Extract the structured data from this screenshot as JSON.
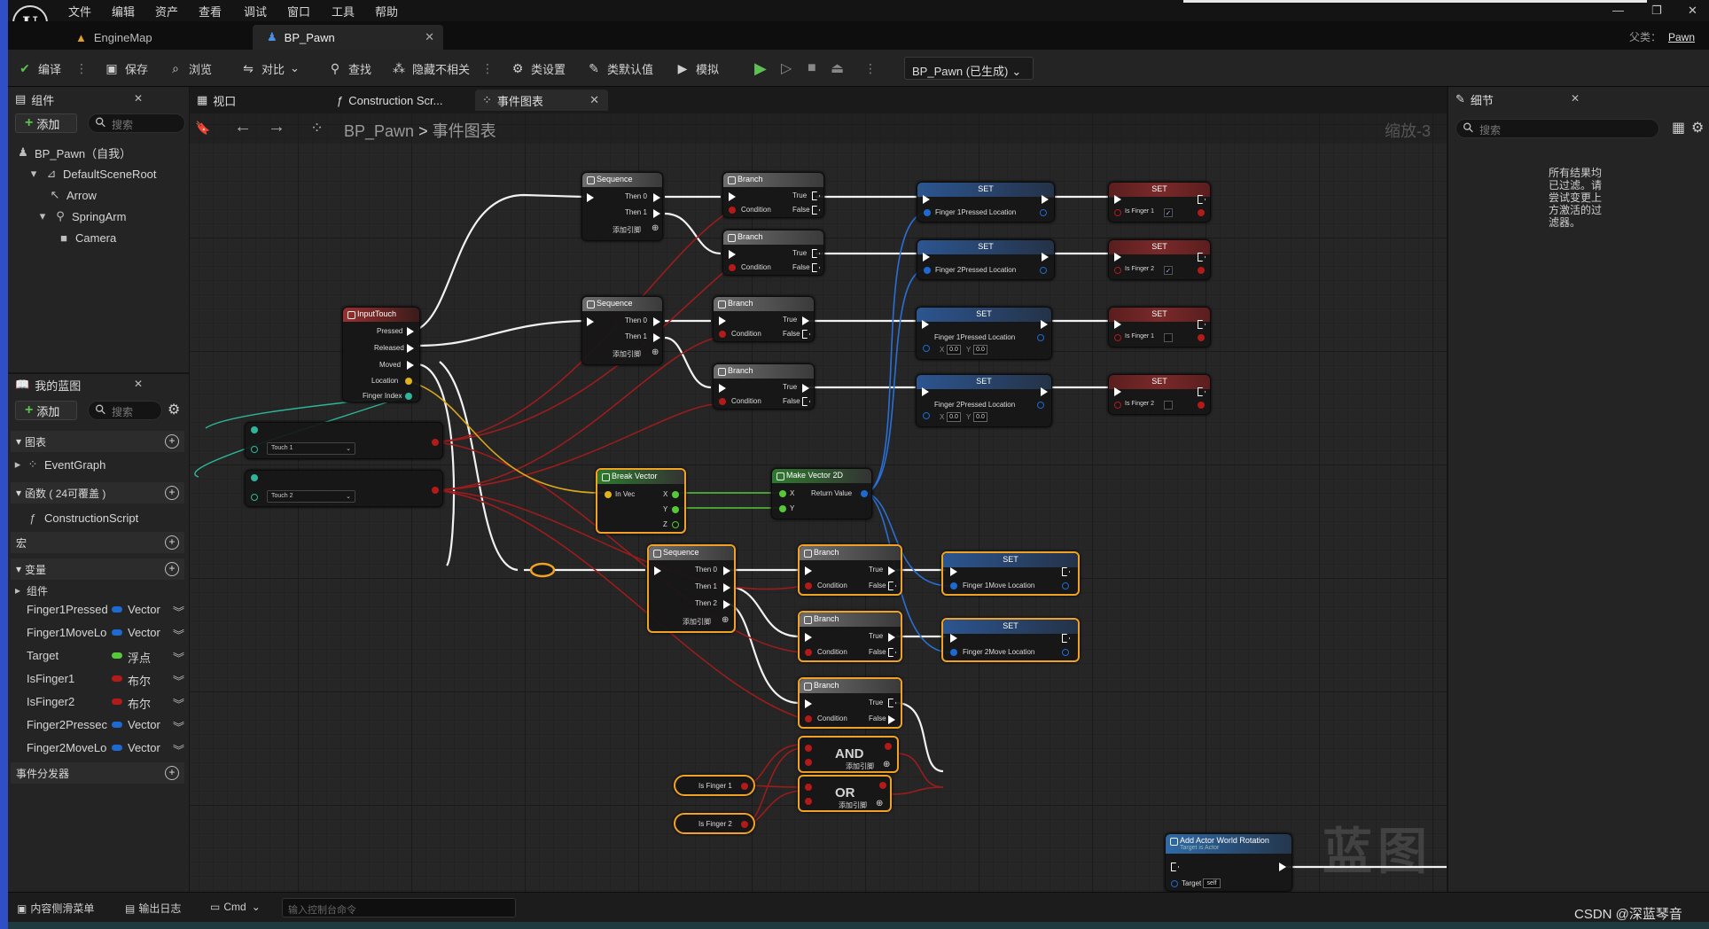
{
  "menu": [
    "文件",
    "编辑",
    "资产",
    "查看",
    "调试",
    "窗口",
    "工具",
    "帮助"
  ],
  "tabs": {
    "engine_map": "EngineMap",
    "bp_pawn": "BP_Pawn",
    "parent_label": "父类：",
    "parent_value": "Pawn"
  },
  "toolbar": {
    "compile": "编译",
    "save": "保存",
    "browse": "浏览",
    "diff": "对比",
    "find": "查找",
    "hide_unrelated": "隐藏不相关",
    "class_settings": "类设置",
    "class_defaults": "类默认值",
    "simulate": "模拟",
    "debug_object": "BP_Pawn (已生成)"
  },
  "components": {
    "tab": "组件",
    "add": "添加",
    "search_placeholder": "搜索",
    "tree": [
      "BP_Pawn（自我）",
      "DefaultSceneRoot",
      "Arrow",
      "SpringArm",
      "Camera"
    ]
  },
  "graph_tabs": {
    "viewport": "视口",
    "construction": "Construction Scr...",
    "event_graph": "事件图表"
  },
  "breadcrumb": {
    "root": "BP_Pawn",
    "sep": ">",
    "current": "事件图表"
  },
  "zoom": "缩放-3",
  "watermark": "蓝图",
  "myblueprint": {
    "tab": "我的蓝图",
    "add": "添加",
    "search_placeholder": "搜索",
    "graphs": "图表",
    "event_graph": "EventGraph",
    "functions": "函数 ( 24可覆盖 )",
    "construction_script": "ConstructionScript",
    "macros": "宏",
    "variables": "变量",
    "components_cat": "组件",
    "dispatchers": "事件分发器",
    "vars": [
      {
        "name": "Finger1Pressed",
        "type": "Vector",
        "color": "#1e6ad0"
      },
      {
        "name": "Finger1MoveLo",
        "type": "Vector",
        "color": "#1e6ad0"
      },
      {
        "name": "Target",
        "type": "浮点",
        "color": "#56c83a"
      },
      {
        "name": "IsFinger1",
        "type": "布尔",
        "color": "#b31a1a"
      },
      {
        "name": "IsFinger2",
        "type": "布尔",
        "color": "#b31a1a"
      },
      {
        "name": "Finger2Pressec",
        "type": "Vector",
        "color": "#1e6ad0"
      },
      {
        "name": "Finger2MoveLo",
        "type": "Vector",
        "color": "#1e6ad0"
      }
    ]
  },
  "details": {
    "tab": "细节",
    "search_placeholder": "搜索",
    "message": "所有结果均已过滤。请尝试变更上方激活的过滤器。"
  },
  "nodes": {
    "sequence": "Sequence",
    "branch": "Branch",
    "set": "SET",
    "input_touch": "InputTouch",
    "pressed": "Pressed",
    "released": "Released",
    "moved": "Moved",
    "location": "Location",
    "finger_index": "Finger Index",
    "then0": "Then 0",
    "then1": "Then 1",
    "then2": "Then 2",
    "add_pin": "添加引脚",
    "true": "True",
    "false": "False",
    "condition": "Condition",
    "f1_pressed": "Finger 1Pressed Location",
    "f2_pressed": "Finger 2Pressed Location",
    "is_finger1": "Is Finger 1",
    "is_finger2": "Is Finger 2",
    "touch1": "Touch 1",
    "touch2": "Touch 2",
    "break_vector": "Break Vector",
    "in_vec": "In Vec",
    "x": "X",
    "y": "Y",
    "z": "Z",
    "make_vector2d": "Make Vector 2D",
    "return_value": "Return Value",
    "f1_move": "Finger 1Move Location",
    "f2_move": "Finger 2Move Location",
    "and": "AND",
    "or": "OR",
    "add_rotation": "Add Actor World Rotation",
    "target_is_actor": "Target is Actor",
    "target": "Target",
    "self": "self",
    "zero": "0.0"
  },
  "bottom": {
    "content_drawer": "内容侧滑菜单",
    "output_log": "输出日志",
    "cmd": "Cmd",
    "cmd_placeholder": "输入控制台命令",
    "watermark_csdn": "CSDN @深蓝琴音"
  }
}
